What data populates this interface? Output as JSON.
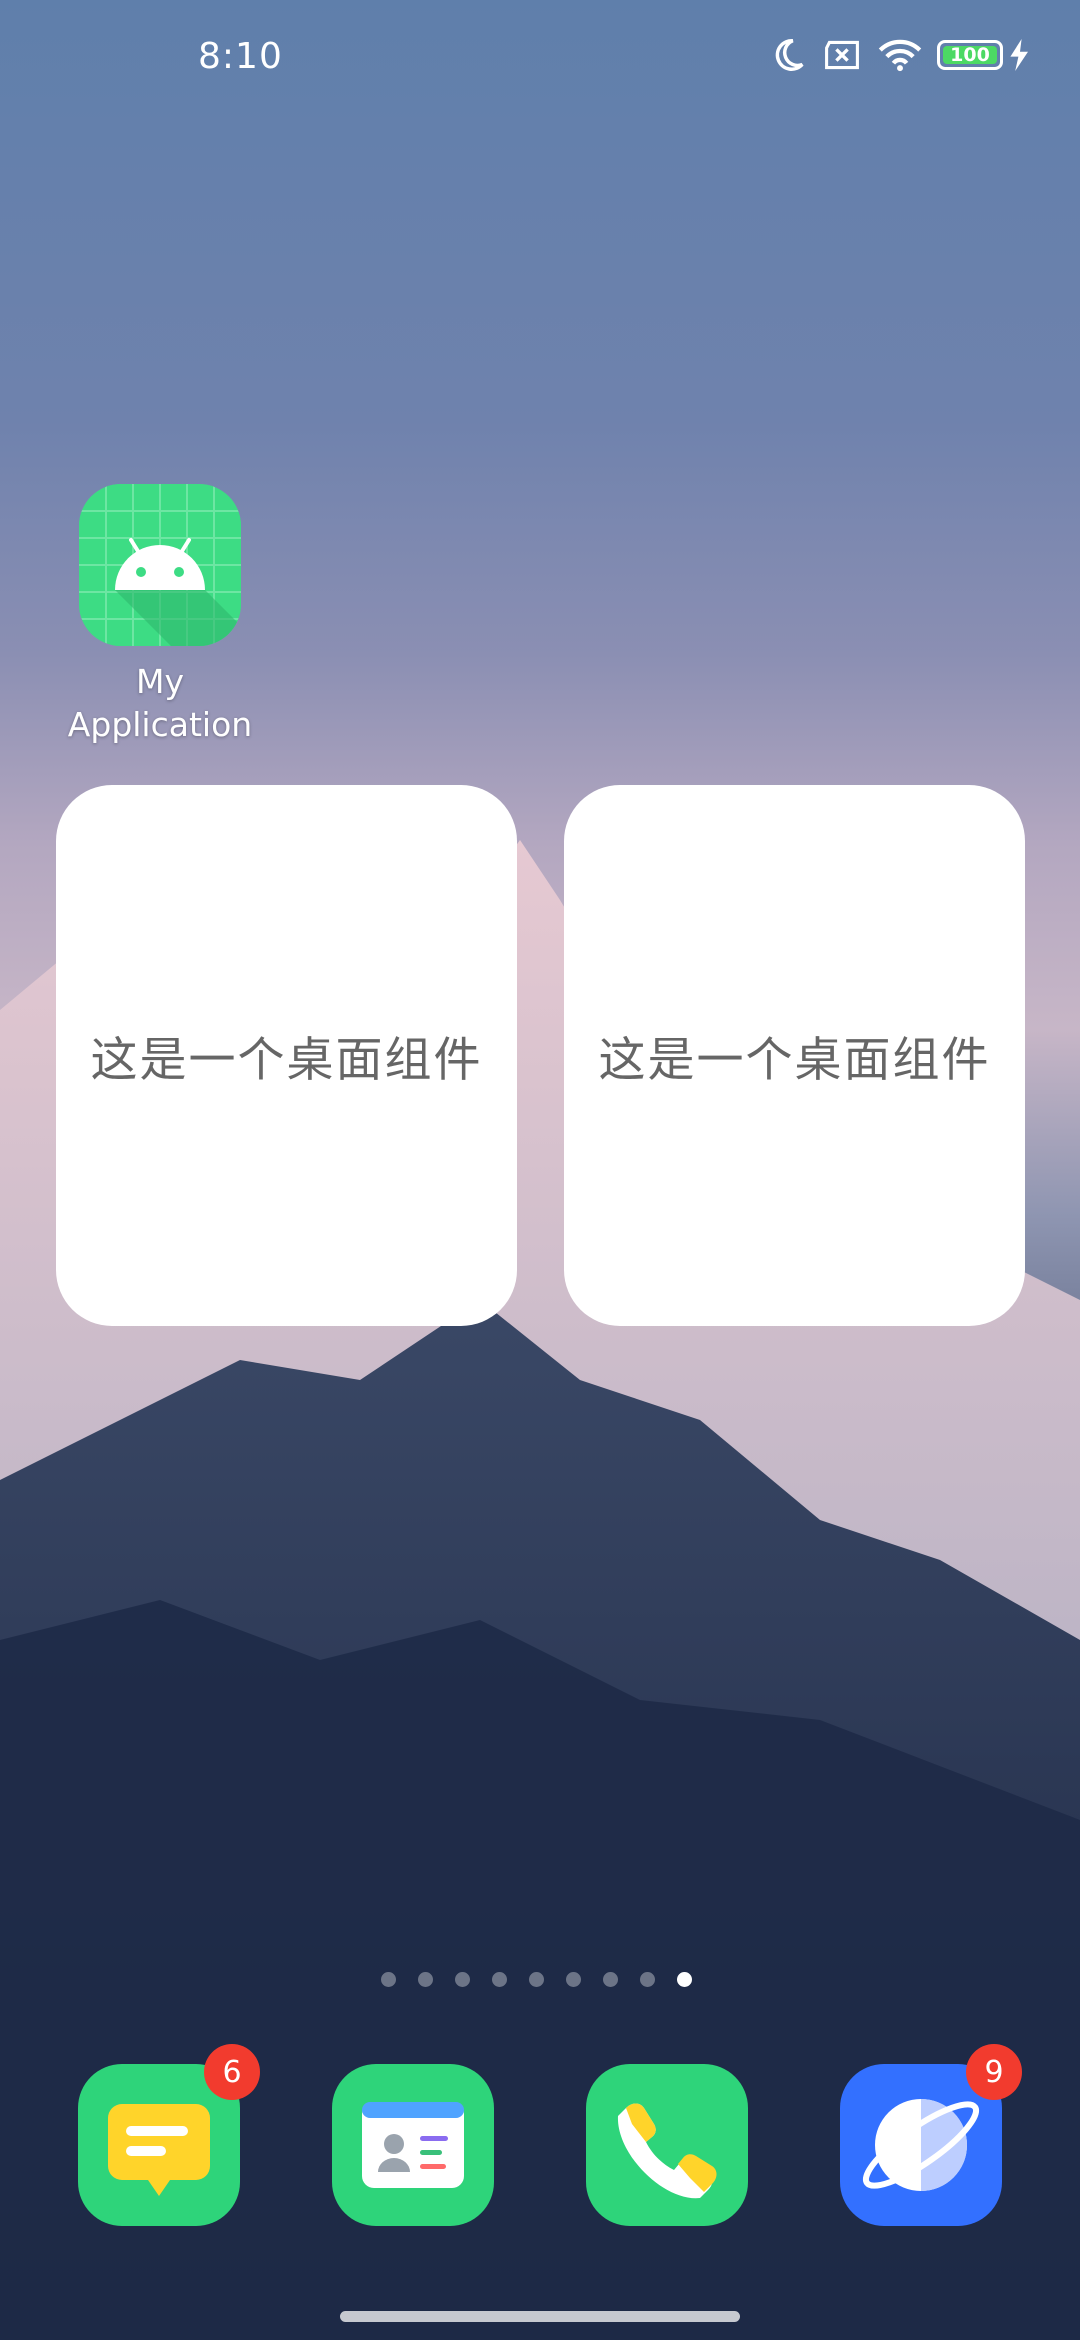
{
  "status_bar": {
    "time": "8:10",
    "battery": "100",
    "icons": [
      "moon-icon",
      "sim-x-icon",
      "wifi-icon",
      "battery-icon",
      "charging-icon"
    ]
  },
  "home": {
    "app": {
      "label_line1": "My",
      "label_line2": "Application",
      "icon": "android-icon"
    },
    "widgets": [
      {
        "text": "这是一个桌面组件"
      },
      {
        "text": "这是一个桌面组件"
      }
    ],
    "page_indicator": {
      "total": 9,
      "active": 9
    }
  },
  "dock": {
    "apps": [
      {
        "name": "messages",
        "icon": "message-icon",
        "badge": "6",
        "color": "#2ed47a"
      },
      {
        "name": "contacts",
        "icon": "contacts-icon",
        "badge": "",
        "color": "#2ed47a"
      },
      {
        "name": "phone",
        "icon": "phone-icon",
        "badge": "",
        "color": "#2ed47a"
      },
      {
        "name": "browser",
        "icon": "browser-icon",
        "badge": "9",
        "color": "#3370ff"
      }
    ]
  }
}
